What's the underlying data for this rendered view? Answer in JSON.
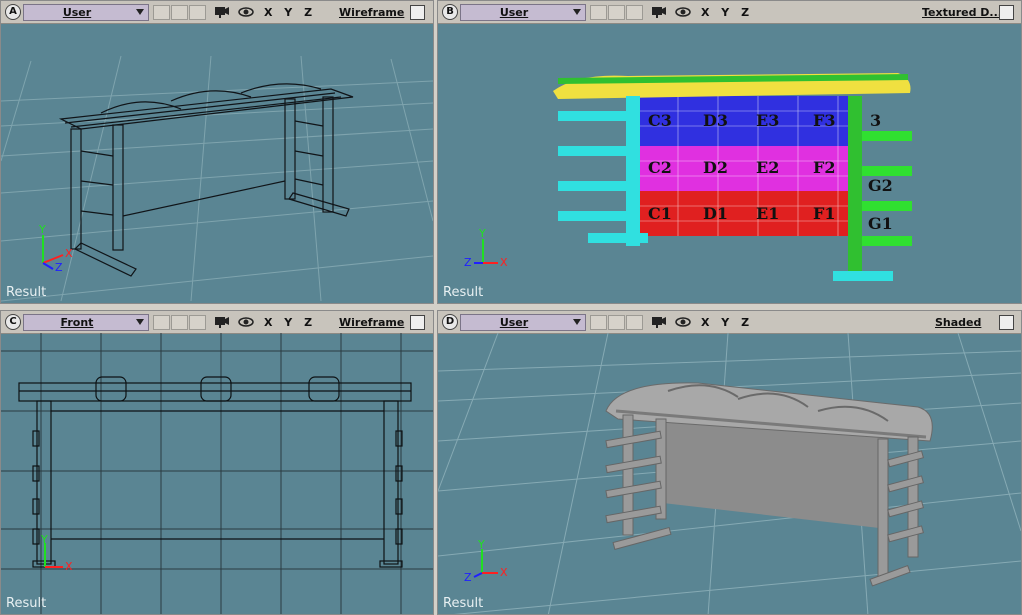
{
  "viewports": [
    {
      "id": "A",
      "letter": "A",
      "view": "User",
      "mode": "Wireframe",
      "footer": "Result"
    },
    {
      "id": "B",
      "letter": "B",
      "view": "User",
      "mode": "Textured D...",
      "footer": "Result"
    },
    {
      "id": "C",
      "letter": "C",
      "view": "Front",
      "mode": "Wireframe",
      "footer": "Result"
    },
    {
      "id": "D",
      "letter": "D",
      "view": "User",
      "mode": "Shaded",
      "footer": "Result"
    }
  ],
  "axes_label": "X Y Z",
  "gizmo": {
    "x": "X",
    "y": "Y",
    "z": "Z"
  },
  "texture_labels": [
    "C3",
    "D3",
    "E3",
    "F3",
    "C2",
    "D2",
    "E2",
    "F2",
    "C1",
    "D1",
    "E1",
    "F1",
    "G2",
    "G1",
    "3"
  ],
  "colors": {
    "viewport_bg": "#5a8593",
    "header_bg": "#c8c4bc",
    "view_field": "#c5bbd1",
    "x_axis": "#ff2020",
    "y_axis": "#20e020",
    "z_axis": "#2020ff"
  }
}
